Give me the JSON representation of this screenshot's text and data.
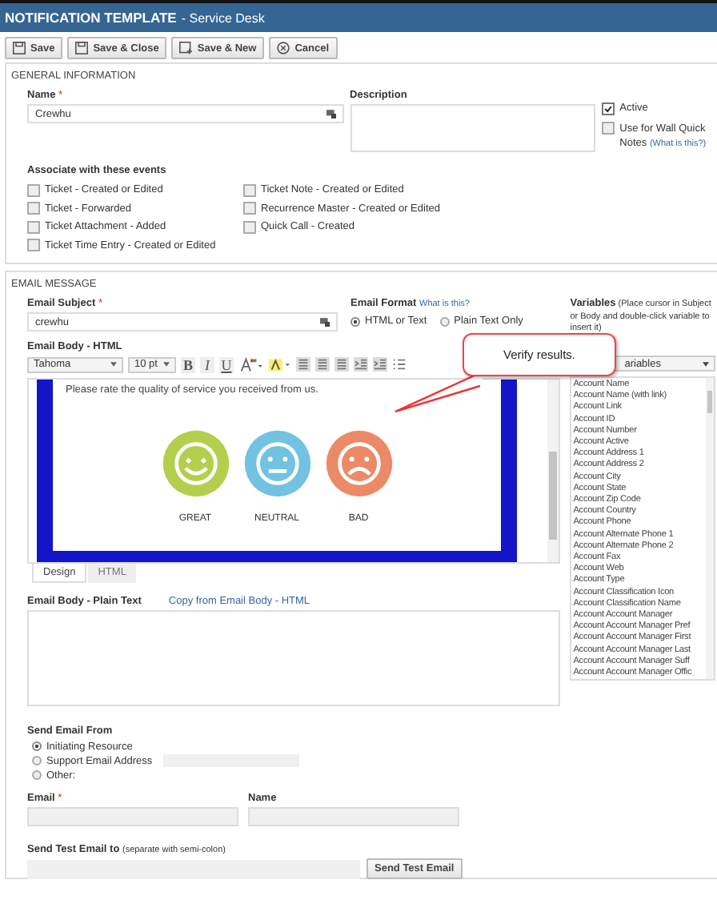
{
  "window": {
    "title": "NOTIFICATION TEMPLATE",
    "subtitle": "- Service Desk"
  },
  "toolbar": [
    {
      "label": "Save",
      "kind": "save"
    },
    {
      "label": "Save & Close",
      "kind": "save"
    },
    {
      "label": "Save & New",
      "kind": "new"
    },
    {
      "label": "Cancel",
      "kind": "cancel"
    }
  ],
  "general": {
    "heading": "GENERAL INFORMATION",
    "name_label": "Name",
    "required": "*",
    "name_value": "Crewhu",
    "description_label": "Description",
    "active": {
      "label": "Active",
      "checked": true
    },
    "wall_notes": {
      "label": "Use for Wall Quick Notes",
      "checked": false,
      "help": "(What is this?)"
    },
    "events_label": "Associate with these events",
    "events": [
      {
        "label": "Ticket - Created or Edited",
        "checked": false
      },
      {
        "label": "Ticket - Forwarded",
        "checked": false
      },
      {
        "label": "Ticket Attachment - Added",
        "checked": false
      },
      {
        "label": "Ticket Time Entry - Created or Edited",
        "checked": false
      },
      {
        "label": "Ticket Note - Created or Edited",
        "checked": false
      },
      {
        "label": "Recurrence Master - Created or Edited",
        "checked": false
      },
      {
        "label": "Quick Call - Created",
        "checked": false
      }
    ]
  },
  "email": {
    "heading": "EMAIL MESSAGE",
    "subject_label": "Email Subject",
    "required": "*",
    "subject_value": "crewhu",
    "format_label": "Email Format",
    "format_help": "What is this?",
    "formats": [
      {
        "label": "HTML or Text",
        "selected": true
      },
      {
        "label": "Plain Text Only",
        "selected": false
      }
    ],
    "variables_label": "Variables",
    "variables_hint": "(Place cursor in Subject or Body and double-click variable to insert it)",
    "variables_select": "ariables",
    "variables": [
      "Account Name",
      "Account Name (with link)",
      "Account Link",
      "Account ID",
      "Account Number",
      "Account Active",
      "Account Address 1",
      "Account Address 2",
      "Account City",
      "Account State",
      "Account Zip Code",
      "Account Country",
      "Account Phone",
      "Account Alternate Phone 1",
      "Account Alternate Phone 2",
      "Account Fax",
      "Account Web",
      "Account Type",
      "Account Classification Icon",
      "Account Classification Name",
      "Account Account Manager",
      "Account Account Manager Pref",
      "Account Account Manager First",
      "Account Account Manager Last",
      "Account Account Manager Suff",
      "Account Account Manager Offic"
    ],
    "body_label": "Email Body - HTML",
    "font": "Tahoma",
    "size": "10 pt",
    "bold": "B",
    "italic": "I",
    "underline": "U",
    "prompt": "Please rate the quality of service you received from us.",
    "ratings": [
      {
        "label": "GREAT",
        "kind": "happy",
        "color": "#b3cf4c"
      },
      {
        "label": "NEUTRAL",
        "kind": "neutral",
        "color": "#72c2e2"
      },
      {
        "label": "BAD",
        "kind": "sad",
        "color": "#ec8a67"
      }
    ],
    "tabs": [
      {
        "label": "Design",
        "selected": true
      },
      {
        "label": "HTML",
        "selected": false
      }
    ],
    "plain_label": "Email Body - Plain Text",
    "copy_link": "Copy from Email Body - HTML",
    "from_label": "Send Email From",
    "from_options": [
      {
        "label": "Initiating Resource",
        "selected": true
      },
      {
        "label": "Support Email Address",
        "selected": false
      },
      {
        "label": "Other:",
        "selected": false
      }
    ],
    "email_label": "Email",
    "email_required": "*",
    "name_label": "Name",
    "test_label": "Send Test Email to",
    "test_hint": "(separate with semi-colon)",
    "test_button": "Send Test Email"
  },
  "callout": "Verify results."
}
